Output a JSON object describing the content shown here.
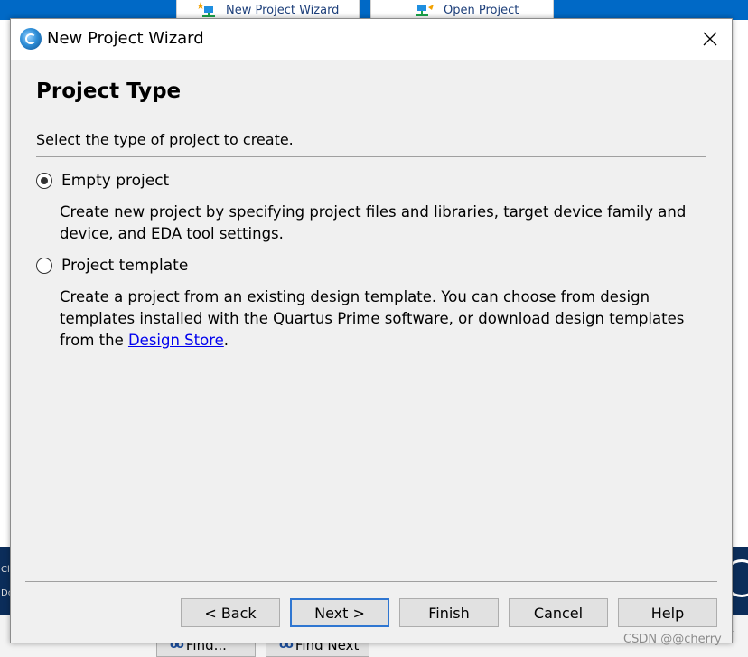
{
  "background": {
    "toolbar_tabs": [
      {
        "label": "New Project Wizard",
        "icon": "new-project-icon"
      },
      {
        "label": "Open Project",
        "icon": "open-project-icon"
      }
    ],
    "left_edge_text": [
      "Cl",
      "Do"
    ],
    "bottom_buttons": [
      {
        "label": "Find...",
        "icon": "binoculars-icon"
      },
      {
        "label": "Find Next",
        "icon": "binoculars-icon"
      }
    ],
    "watermark": "CSDN @@cherry"
  },
  "dialog": {
    "title": "New Project Wizard",
    "heading": "Project Type",
    "subtitle": "Select the type of project to create.",
    "options": [
      {
        "label": "Empty project",
        "checked": true,
        "description": "Create new project by specifying project files and libraries, target device family and device, and EDA tool settings."
      },
      {
        "label": "Project template",
        "checked": false,
        "description_before_link": "Create a project from an existing design template. You can choose from design templates installed with the Quartus Prime software, or download design templates from the ",
        "link_text": "Design Store",
        "description_after_link": "."
      }
    ],
    "buttons": {
      "back": "< Back",
      "next": "Next >",
      "finish": "Finish",
      "cancel": "Cancel",
      "help": "Help"
    }
  },
  "colors": {
    "background_blue": "#0069c6",
    "dialog_bg": "#f0f0f0",
    "link": "#0000ee",
    "default_button_border": "#2f76d1"
  }
}
